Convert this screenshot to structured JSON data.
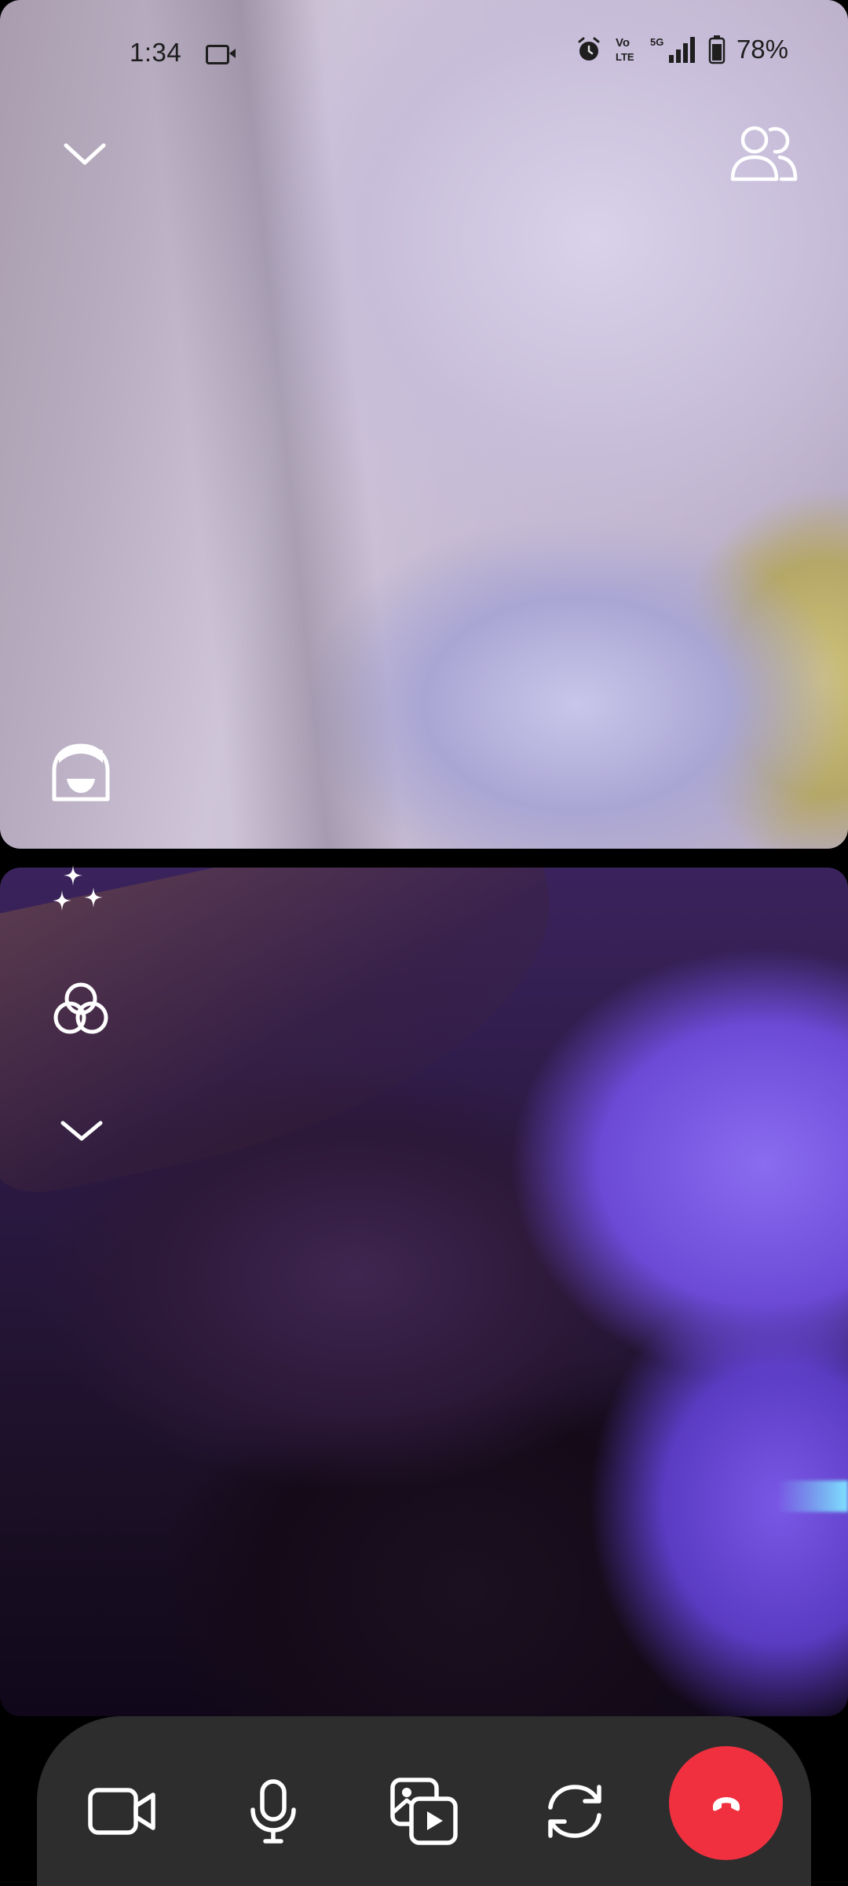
{
  "status_bar": {
    "time": "1:34",
    "battery_percent": "78%",
    "icons": [
      "video-recording-icon",
      "alarm-icon",
      "volte-icon",
      "5g-icon",
      "signal-icon",
      "battery-icon"
    ]
  },
  "call": {
    "top_controls": {
      "minimize_icon": "chevron-down-icon",
      "participants_icon": "participants-icon"
    },
    "side_tools": [
      "avatar-reaction-icon",
      "effects-sparkle-icon",
      "filters-icon",
      "more-chevron-icon"
    ],
    "bottom_controls": [
      {
        "name": "video-toggle",
        "icon": "video-camera-icon"
      },
      {
        "name": "mute-toggle",
        "icon": "microphone-icon"
      },
      {
        "name": "share-media",
        "icon": "media-share-icon"
      },
      {
        "name": "flip-camera",
        "icon": "flip-camera-icon"
      },
      {
        "name": "end-call",
        "icon": "hang-up-icon"
      }
    ]
  },
  "colors": {
    "end_call": "#f0303f",
    "control_bar": "#2d2d2d",
    "icon": "#ffffff"
  }
}
